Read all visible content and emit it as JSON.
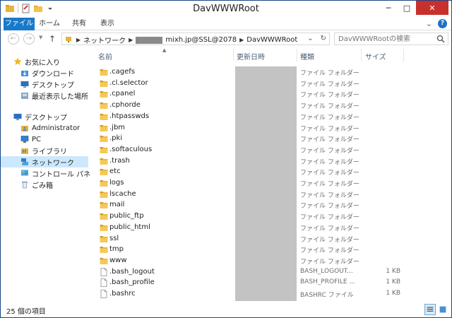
{
  "window": {
    "title": "DavWWWRoot",
    "controls": {
      "minimize": "─",
      "maximize": "□",
      "close": "✕"
    }
  },
  "ribbon": {
    "tabs": [
      "ファイル",
      "ホーム",
      "共有",
      "表示"
    ],
    "expand": "⌄",
    "help": "?"
  },
  "address": {
    "crumbs": [
      "ネットワーク",
      "mixh.jp@SSL@2078",
      "DavWWWRoot"
    ],
    "dropdown": "⌄",
    "refresh": "↻"
  },
  "search": {
    "placeholder": "DavWWWRootの検索"
  },
  "nav_pane": {
    "favorites": {
      "label": "お気に入り",
      "items": [
        "ダウンロード",
        "デスクトップ",
        "最近表示した場所"
      ]
    },
    "desktop": {
      "label": "デスクトップ",
      "items": [
        "Administrator",
        "PC",
        "ライブラリ",
        "ネットワーク",
        "コントロール パネル",
        "ごみ箱"
      ]
    }
  },
  "columns": {
    "name": "名前",
    "modified": "更新日時",
    "type": "種類",
    "size": "サイズ"
  },
  "files": [
    {
      "name": ".cagefs",
      "type": "ファイル フォルダー",
      "size": "",
      "kind": "folder"
    },
    {
      "name": ".cl.selector",
      "type": "ファイル フォルダー",
      "size": "",
      "kind": "folder"
    },
    {
      "name": ".cpanel",
      "type": "ファイル フォルダー",
      "size": "",
      "kind": "folder"
    },
    {
      "name": ".cphorde",
      "type": "ファイル フォルダー",
      "size": "",
      "kind": "folder"
    },
    {
      "name": ".htpasswds",
      "type": "ファイル フォルダー",
      "size": "",
      "kind": "folder"
    },
    {
      "name": ".jbm",
      "type": "ファイル フォルダー",
      "size": "",
      "kind": "folder"
    },
    {
      "name": ".pki",
      "type": "ファイル フォルダー",
      "size": "",
      "kind": "folder"
    },
    {
      "name": ".softaculous",
      "type": "ファイル フォルダー",
      "size": "",
      "kind": "folder"
    },
    {
      "name": ".trash",
      "type": "ファイル フォルダー",
      "size": "",
      "kind": "folder"
    },
    {
      "name": "etc",
      "type": "ファイル フォルダー",
      "size": "",
      "kind": "folder"
    },
    {
      "name": "logs",
      "type": "ファイル フォルダー",
      "size": "",
      "kind": "folder"
    },
    {
      "name": "lscache",
      "type": "ファイル フォルダー",
      "size": "",
      "kind": "folder"
    },
    {
      "name": "mail",
      "type": "ファイル フォルダー",
      "size": "",
      "kind": "folder"
    },
    {
      "name": "public_ftp",
      "type": "ファイル フォルダー",
      "size": "",
      "kind": "folder"
    },
    {
      "name": "public_html",
      "type": "ファイル フォルダー",
      "size": "",
      "kind": "folder"
    },
    {
      "name": "ssl",
      "type": "ファイル フォルダー",
      "size": "",
      "kind": "folder"
    },
    {
      "name": "tmp",
      "type": "ファイル フォルダー",
      "size": "",
      "kind": "folder"
    },
    {
      "name": "www",
      "type": "ファイル フォルダー",
      "size": "",
      "kind": "folder"
    },
    {
      "name": ".bash_logout",
      "type": "BASH_LOGOUT...",
      "size": "1 KB",
      "kind": "file"
    },
    {
      "name": ".bash_profile",
      "type": "BASH_PROFILE ...",
      "size": "1 KB",
      "kind": "file"
    },
    {
      "name": ".bashrc",
      "type": "BASHRC ファイル",
      "size": "1 KB",
      "kind": "file"
    }
  ],
  "status": {
    "count": "25 個の項目"
  },
  "colors": {
    "accent": "#1979ca",
    "selection": "#cce8ff",
    "folder": "#e8b43c",
    "close": "#c7302b"
  }
}
